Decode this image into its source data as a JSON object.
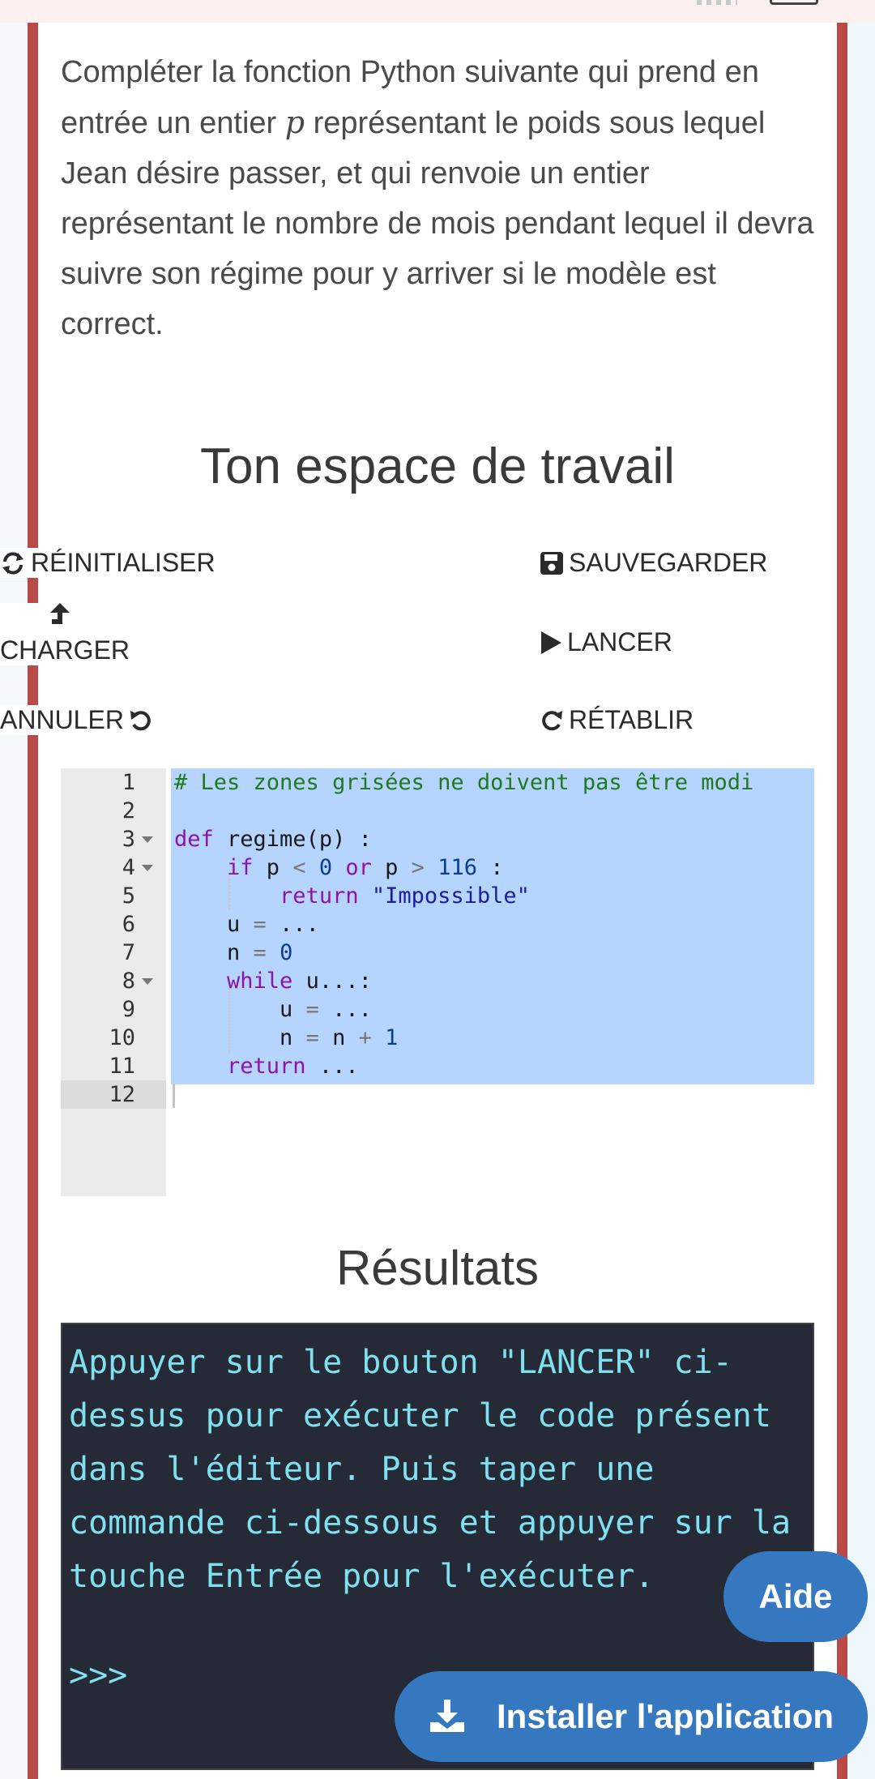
{
  "intro": {
    "text_before": "Compléter la fonction Python suivante qui prend en entrée un entier ",
    "variable": "p",
    "text_after": " représentant le poids sous lequel Jean désire passer, et qui renvoie un entier représentant le nombre de mois pendant lequel il devra suivre son régime pour y arriver si le modèle est correct."
  },
  "workspace": {
    "title": "Ton espace de travail",
    "buttons": {
      "reset": "RÉINITIALISER",
      "save": "SAUVEGARDER",
      "load": "CHARGER",
      "run": "LANCER",
      "undo": "ANNULER",
      "redo": "RÉTABLIR"
    }
  },
  "editor": {
    "line_numbers": [
      "1",
      "2",
      "3",
      "4",
      "5",
      "6",
      "7",
      "8",
      "9",
      "10",
      "11",
      "12"
    ],
    "lines": {
      "l1": "# Les zones grisées ne doivent pas être modi",
      "l3_kw": "def",
      "l3_rest": " regime(p) :",
      "l4_kw": "if",
      "l4_a": " p ",
      "l4_op1": "<",
      "l4_num1": " 0 ",
      "l4_or": "or",
      "l4_b": " p ",
      "l4_op2": ">",
      "l4_num2": " 116",
      "l4_c": " :",
      "l5_kw": "return",
      "l5_str": " \"Impossible\"",
      "l6_a": "u ",
      "l6_op": "=",
      "l6_b": " ...",
      "l7_a": "n ",
      "l7_op": "=",
      "l7_num": " 0",
      "l8_kw": "while",
      "l8_rest": " u...:",
      "l9_a": "u ",
      "l9_op": "=",
      "l9_b": " ...",
      "l10_a": "n ",
      "l10_op": "=",
      "l10_b": " n ",
      "l10_op2": "+",
      "l10_num": " 1",
      "l11_kw": "return",
      "l11_b": " ..."
    }
  },
  "results": {
    "title": "Résultats",
    "terminal_text": "Appuyer sur le bouton \"LANCER\" ci-dessus pour exécuter le code présent dans l'éditeur. Puis taper une commande ci-dessous et appuyer sur la touche Entrée pour l'exécuter.",
    "prompt": ">>>"
  },
  "fab": {
    "help": "Aide",
    "install": "Installer l'application"
  },
  "colors": {
    "accent_border": "#b94a48",
    "selection": "#b5d5ff",
    "terminal_bg": "#252a36",
    "terminal_text": "#7fe0f0",
    "fab": "#3578c0"
  }
}
